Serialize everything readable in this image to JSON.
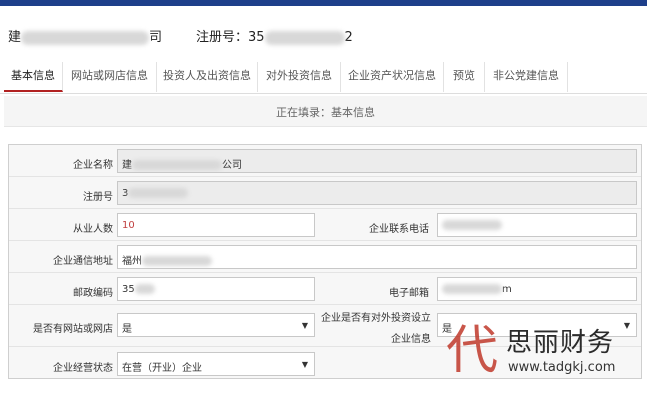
{
  "header": {
    "company_prefix": "建",
    "company_suffix": "司",
    "regno_label": "注册号：35",
    "regno_suffix": "2"
  },
  "tabs": [
    {
      "label": "基本信息",
      "active": true
    },
    {
      "label": "网站或网店信息",
      "active": false
    },
    {
      "label": "投资人及出资信息",
      "active": false
    },
    {
      "label": "对外投资信息",
      "active": false
    },
    {
      "label": "企业资产状况信息",
      "active": false
    },
    {
      "label": "预览",
      "active": false
    },
    {
      "label": "非公党建信息",
      "active": false
    }
  ],
  "status": "正在填录：基本信息",
  "form": {
    "company_name_label": "企业名称",
    "company_name_prefix": "建",
    "company_name_suffix": "公司",
    "regno_label": "注册号",
    "regno_value": "3",
    "employees_label": "从业人数",
    "employees_value": "10",
    "phone_label": "企业联系电话",
    "address_label": "企业通信地址",
    "address_value": "福州",
    "postcode_label": "邮政编码",
    "postcode_value": "35",
    "email_label": "电子邮箱",
    "email_suffix": "m",
    "has_website_label": "是否有网站或网店",
    "has_website_value": "是",
    "invest_label_line1": "企业是否有对外投资设立",
    "invest_label_line2": "企业信息",
    "invest_value": "是",
    "op_status_label": "企业经营状态",
    "op_status_value": "在营（开业）企业"
  },
  "watermark": {
    "mark": "代",
    "brand": "思丽财务",
    "url": "www.tadgkj.com"
  },
  "icons": {
    "select_caret": "caret-down-icon"
  }
}
